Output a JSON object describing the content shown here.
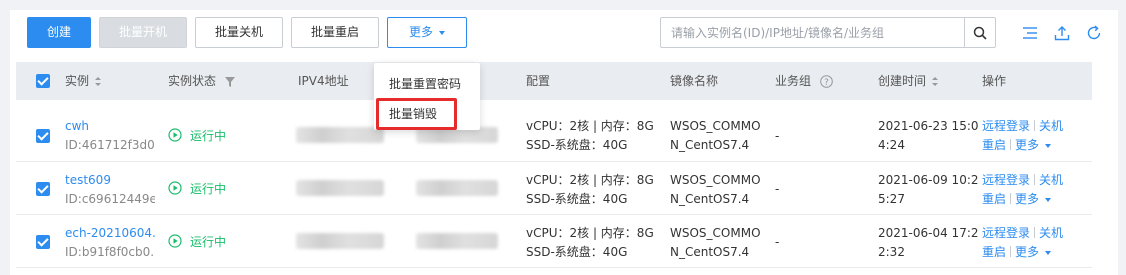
{
  "toolbar": {
    "create_label": "创建",
    "batch_start_label": "批量开机",
    "batch_shutdown_label": "批量关机",
    "batch_restart_label": "批量重启",
    "more_label": "更多"
  },
  "search": {
    "placeholder": "请输入实例名(ID)/IP地址/镜像名/业务组"
  },
  "icons": {
    "search": "search-icon",
    "list": "list-icon",
    "export": "upload-icon",
    "refresh": "refresh-icon"
  },
  "dropdown": {
    "items": [
      {
        "label": "批量重置密码"
      },
      {
        "label": "批量销毁"
      }
    ]
  },
  "table": {
    "headers": {
      "instance": "实例",
      "status": "实例状态",
      "ipv4": "IPV4地址",
      "config": "配置",
      "image": "镜像名称",
      "group": "业务组",
      "created": "创建时间",
      "actions": "操作"
    },
    "rows": [
      {
        "name": "cwh",
        "id": "ID:461712f3d0...",
        "status": "运行中",
        "config1": "vCPU：2核 | 内存：8G",
        "config2": "SSD-系统盘：40G",
        "image1": "WSOS_COMMO",
        "image2": "N_CentOS7.4",
        "group": "-",
        "time1": "2021-06-23 15:0",
        "time2": "4:24",
        "action_login": "远程登录",
        "action_shutdown": "关机",
        "action_restart": "重启",
        "action_more": "更多"
      },
      {
        "name": "test609",
        "id": "ID:c69612449e...",
        "status": "运行中",
        "config1": "vCPU：2核 | 内存：8G",
        "config2": "SSD-系统盘：40G",
        "image1": "WSOS_COMMO",
        "image2": "N_CentOS7.4",
        "group": "-",
        "time1": "2021-06-09 10:2",
        "time2": "5:27",
        "action_login": "远程登录",
        "action_shutdown": "关机",
        "action_restart": "重启",
        "action_more": "更多"
      },
      {
        "name": "ech-20210604...",
        "id": "ID:b91f8f0cb0...",
        "status": "运行中",
        "config1": "vCPU：2核 | 内存：8G",
        "config2": "SSD-系统盘：40G",
        "image1": "WSOS_COMMO",
        "image2": "N_CentOS7.4",
        "group": "-",
        "time1": "2021-06-04 17:2",
        "time2": "2:32",
        "action_login": "远程登录",
        "action_shutdown": "关机",
        "action_restart": "重启",
        "action_more": "更多"
      }
    ]
  },
  "colors": {
    "primary": "#2d8cf0",
    "running": "#19be6b",
    "highlight": "#e52b2b",
    "header_bg": "#e9ecf0"
  }
}
